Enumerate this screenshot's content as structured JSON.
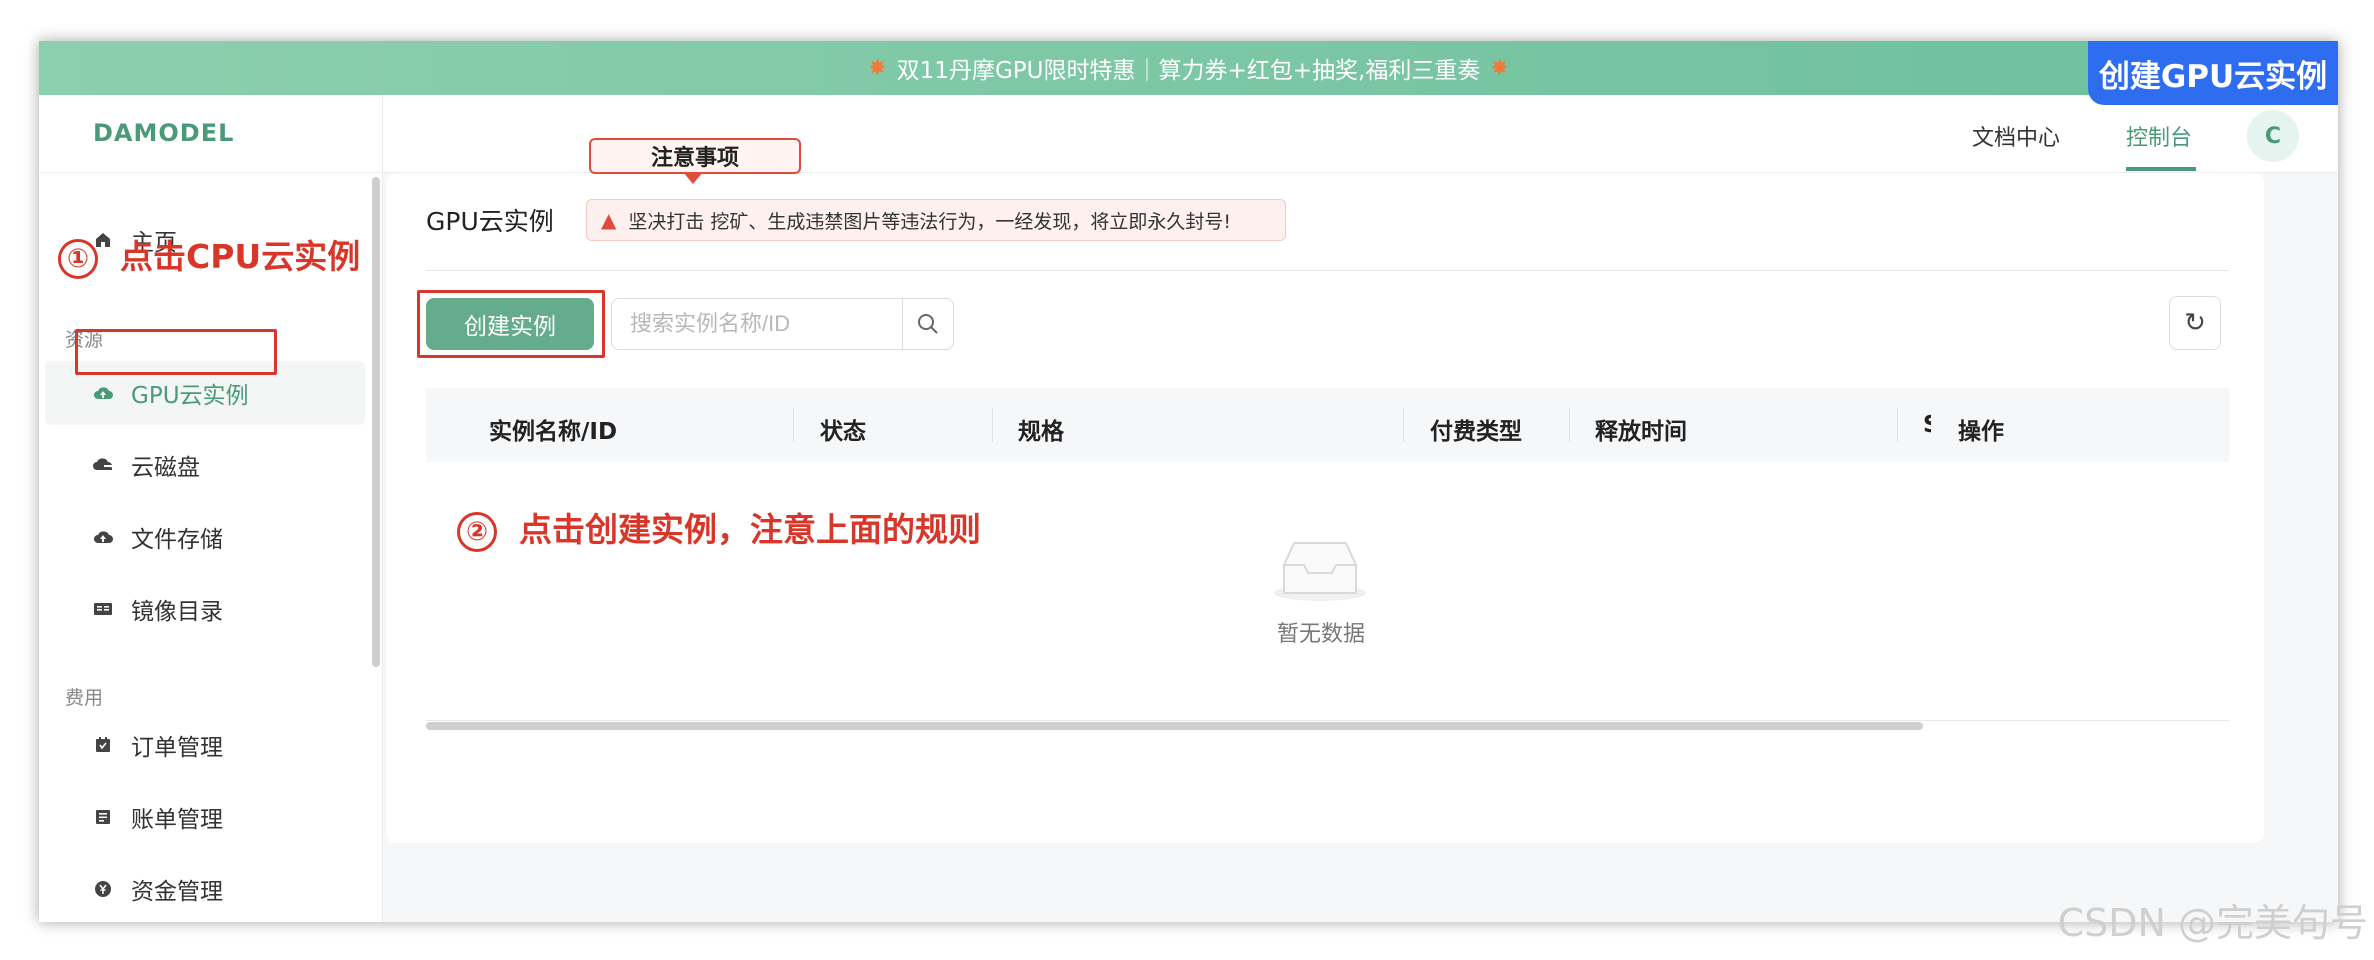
{
  "banner": {
    "text": "双11丹摩GPU限时特惠｜算力券+红包+抽奖,福利三重奏",
    "burst_icon": "firework-icon"
  },
  "corner_tag": "创建GPU云实例",
  "header": {
    "logo": "DAMODEL",
    "nav": [
      "文档中心",
      "控制台"
    ],
    "active_nav": "控制台",
    "avatar_letter": "C"
  },
  "sidebar": {
    "home": {
      "label": "主页",
      "icon": "home-icon"
    },
    "resources_label": "资源",
    "resources": [
      {
        "label": "GPU云实例",
        "icon": "cloud-upload-icon",
        "active": true
      },
      {
        "label": "云磁盘",
        "icon": "cloud-disk-icon"
      },
      {
        "label": "文件存储",
        "icon": "cloud-icon"
      },
      {
        "label": "镜像目录",
        "icon": "book-icon"
      }
    ],
    "billing_label": "费用",
    "billing": [
      {
        "label": "订单管理",
        "icon": "order-icon"
      },
      {
        "label": "账单管理",
        "icon": "bill-icon"
      },
      {
        "label": "资金管理",
        "icon": "yen-icon"
      }
    ]
  },
  "main": {
    "title": "GPU云实例",
    "notice_badge": "注意事项",
    "warning_text": "坚决打击 挖矿、生成违禁图片等违法行为，一经发现，将立即永久封号!",
    "create_button": "创建实例",
    "search_placeholder": "搜索实例名称/ID",
    "table_headers": [
      "实例名称/ID",
      "状态",
      "规格",
      "付费类型",
      "释放时间",
      "S",
      "操作"
    ],
    "empty_text": "暂无数据"
  },
  "annotations": {
    "step1_number": "①",
    "step1": "点击CPU云实例",
    "step2_number": "②",
    "step2": "点击创建实例，注意上面的规则"
  },
  "watermark": "CSDN @完美句号",
  "colors": {
    "brand_green": "#4a9a7a",
    "button_green": "#64ac8b",
    "banner_green": "#6dbf9c",
    "annotation_red": "#d9362a",
    "corner_blue": "#2f6df0"
  }
}
